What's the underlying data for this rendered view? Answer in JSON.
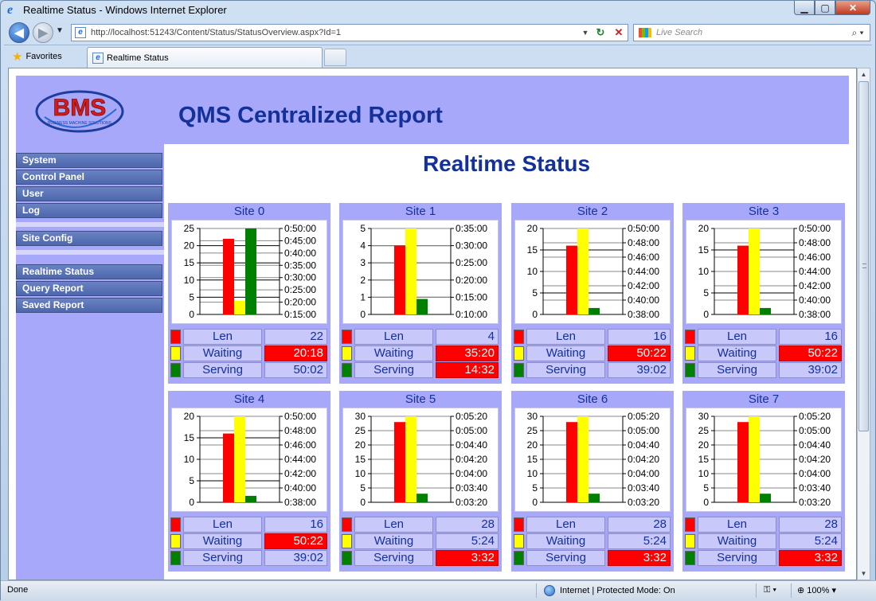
{
  "window": {
    "title": "Realtime Status - Windows Internet Explorer"
  },
  "toolbar": {
    "url": "http://localhost:51243/Content/Status/StatusOverview.aspx?Id=1",
    "search_placeholder": "Live Search",
    "favorites_label": "Favorites",
    "tab_title": "Realtime Status"
  },
  "status_bar": {
    "text": "Done",
    "zone": "Internet | Protected Mode: On",
    "zoom": "100%"
  },
  "header": {
    "logo_text": "BMS",
    "logo_tagline": "BUSINESS MACHINE SOLUTIONS",
    "title": "QMS Centralized Report"
  },
  "sidebar": {
    "group1": [
      "System",
      "Control Panel",
      "User",
      "Log"
    ],
    "group2": [
      "Site Config"
    ],
    "group3": [
      "Realtime Status",
      "Query Report",
      "Saved Report"
    ]
  },
  "main": {
    "title": "Realtime Status"
  },
  "colors": {
    "len": "#ff0000",
    "waiting": "#ffff00",
    "serving": "#008000",
    "panel": "#a8a8fa",
    "title": "#14319a"
  },
  "legend_labels": {
    "len": "Len",
    "waiting": "Waiting",
    "serving": "Serving"
  },
  "chart_data": [
    {
      "type": "bar",
      "title": "Site 0",
      "series": [
        {
          "name": "Len",
          "values": [
            22
          ]
        },
        {
          "name": "Waiting",
          "values": [
            4
          ]
        },
        {
          "name": "Serving",
          "values": [
            25
          ]
        }
      ],
      "y_left_ticks": [
        "0",
        "5",
        "10",
        "15",
        "20",
        "25"
      ],
      "y_right_ticks": [
        "0:15:00",
        "0:20:00",
        "0:25:00",
        "0:30:00",
        "0:35:00",
        "0:40:00",
        "0:45:00",
        "0:50:00"
      ],
      "ylim": [
        0,
        25
      ],
      "stats": {
        "len": "22",
        "waiting": "20:18",
        "serving": "50:02",
        "waiting_alert": true,
        "serving_alert": false
      }
    },
    {
      "type": "bar",
      "title": "Site 1",
      "series": [
        {
          "name": "Len",
          "values": [
            4
          ]
        },
        {
          "name": "Waiting",
          "values": [
            5
          ]
        },
        {
          "name": "Serving",
          "values": [
            0.9
          ]
        }
      ],
      "y_left_ticks": [
        "0",
        "1",
        "2",
        "3",
        "4",
        "5"
      ],
      "y_right_ticks": [
        "0:10:00",
        "0:15:00",
        "0:20:00",
        "0:25:00",
        "0:30:00",
        "0:35:00"
      ],
      "ylim": [
        0,
        5
      ],
      "stats": {
        "len": "4",
        "waiting": "35:20",
        "serving": "14:32",
        "waiting_alert": true,
        "serving_alert": true
      }
    },
    {
      "type": "bar",
      "title": "Site 2",
      "series": [
        {
          "name": "Len",
          "values": [
            16
          ]
        },
        {
          "name": "Waiting",
          "values": [
            20
          ]
        },
        {
          "name": "Serving",
          "values": [
            1.5
          ]
        }
      ],
      "y_left_ticks": [
        "0",
        "5",
        "10",
        "15",
        "20"
      ],
      "y_right_ticks": [
        "0:38:00",
        "0:40:00",
        "0:42:00",
        "0:44:00",
        "0:46:00",
        "0:48:00",
        "0:50:00"
      ],
      "ylim": [
        0,
        20
      ],
      "stats": {
        "len": "16",
        "waiting": "50:22",
        "serving": "39:02",
        "waiting_alert": true,
        "serving_alert": false
      }
    },
    {
      "type": "bar",
      "title": "Site 3",
      "series": [
        {
          "name": "Len",
          "values": [
            16
          ]
        },
        {
          "name": "Waiting",
          "values": [
            20
          ]
        },
        {
          "name": "Serving",
          "values": [
            1.5
          ]
        }
      ],
      "y_left_ticks": [
        "0",
        "5",
        "10",
        "15",
        "20"
      ],
      "y_right_ticks": [
        "0:38:00",
        "0:40:00",
        "0:42:00",
        "0:44:00",
        "0:46:00",
        "0:48:00",
        "0:50:00"
      ],
      "ylim": [
        0,
        20
      ],
      "stats": {
        "len": "16",
        "waiting": "50:22",
        "serving": "39:02",
        "waiting_alert": true,
        "serving_alert": false
      }
    },
    {
      "type": "bar",
      "title": "Site 4",
      "series": [
        {
          "name": "Len",
          "values": [
            16
          ]
        },
        {
          "name": "Waiting",
          "values": [
            20
          ]
        },
        {
          "name": "Serving",
          "values": [
            1.5
          ]
        }
      ],
      "y_left_ticks": [
        "0",
        "5",
        "10",
        "15",
        "20"
      ],
      "y_right_ticks": [
        "0:38:00",
        "0:40:00",
        "0:42:00",
        "0:44:00",
        "0:46:00",
        "0:48:00",
        "0:50:00"
      ],
      "ylim": [
        0,
        20
      ],
      "stats": {
        "len": "16",
        "waiting": "50:22",
        "serving": "39:02",
        "waiting_alert": true,
        "serving_alert": false
      }
    },
    {
      "type": "bar",
      "title": "Site 5",
      "series": [
        {
          "name": "Len",
          "values": [
            28
          ]
        },
        {
          "name": "Waiting",
          "values": [
            30
          ]
        },
        {
          "name": "Serving",
          "values": [
            3
          ]
        }
      ],
      "y_left_ticks": [
        "0",
        "5",
        "10",
        "15",
        "20",
        "25",
        "30"
      ],
      "y_right_ticks": [
        "0:03:20",
        "0:03:40",
        "0:04:00",
        "0:04:20",
        "0:04:40",
        "0:05:00",
        "0:05:20"
      ],
      "ylim": [
        0,
        30
      ],
      "stats": {
        "len": "28",
        "waiting": "5:24",
        "serving": "3:32",
        "waiting_alert": false,
        "serving_alert": true
      }
    },
    {
      "type": "bar",
      "title": "Site 6",
      "series": [
        {
          "name": "Len",
          "values": [
            28
          ]
        },
        {
          "name": "Waiting",
          "values": [
            30
          ]
        },
        {
          "name": "Serving",
          "values": [
            3
          ]
        }
      ],
      "y_left_ticks": [
        "0",
        "5",
        "10",
        "15",
        "20",
        "25",
        "30"
      ],
      "y_right_ticks": [
        "0:03:20",
        "0:03:40",
        "0:04:00",
        "0:04:20",
        "0:04:40",
        "0:05:00",
        "0:05:20"
      ],
      "ylim": [
        0,
        30
      ],
      "stats": {
        "len": "28",
        "waiting": "5:24",
        "serving": "3:32",
        "waiting_alert": false,
        "serving_alert": true
      }
    },
    {
      "type": "bar",
      "title": "Site 7",
      "series": [
        {
          "name": "Len",
          "values": [
            28
          ]
        },
        {
          "name": "Waiting",
          "values": [
            30
          ]
        },
        {
          "name": "Serving",
          "values": [
            3
          ]
        }
      ],
      "y_left_ticks": [
        "0",
        "5",
        "10",
        "15",
        "20",
        "25",
        "30"
      ],
      "y_right_ticks": [
        "0:03:20",
        "0:03:40",
        "0:04:00",
        "0:04:20",
        "0:04:40",
        "0:05:00",
        "0:05:20"
      ],
      "ylim": [
        0,
        30
      ],
      "stats": {
        "len": "28",
        "waiting": "5:24",
        "serving": "3:32",
        "waiting_alert": false,
        "serving_alert": true
      }
    }
  ]
}
